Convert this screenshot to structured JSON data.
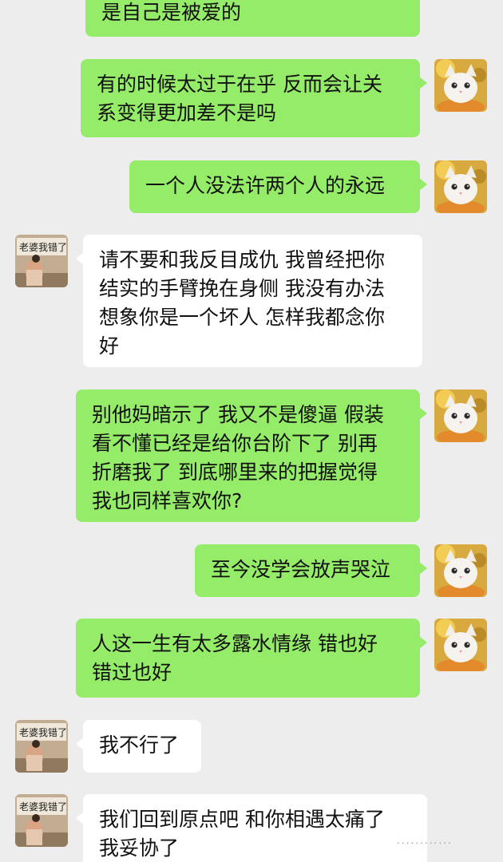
{
  "messages": [
    {
      "sender": "me",
      "text": "是自己是被爱的"
    },
    {
      "sender": "me",
      "text": "有的时候太过于在乎 反而会让关\n系变得更加差不是吗"
    },
    {
      "sender": "me",
      "text": "一个人没法许两个人的永远"
    },
    {
      "sender": "them",
      "text": "请不要和我反目成仇 我曾经把你\n结实的手臂挽在身侧 我没有办法\n想象你是一个坏人 怎样我都念你\n好"
    },
    {
      "sender": "me",
      "text": "别他妈暗示了 我又不是傻逼 假装\n看不懂已经是给你台阶下了 别再\n折磨我了 到底哪里来的把握觉得\n我也同样喜欢你?"
    },
    {
      "sender": "me",
      "text": "至今没学会放声哭泣"
    },
    {
      "sender": "me",
      "text": "人这一生有太多露水情缘 错也好\n错过也好"
    },
    {
      "sender": "them",
      "text": "我不行了"
    },
    {
      "sender": "them",
      "text": "我们回到原点吧 和你相遇太痛了\n我妥协了"
    }
  ],
  "avatars": {
    "me": {
      "icon": "kitten-avatar"
    },
    "them": {
      "icon": "person-with-sign-avatar",
      "sign_text": "老婆我错了"
    }
  },
  "watermark": "............",
  "colors": {
    "background": "#ededed",
    "my_bubble": "#95ec69",
    "their_bubble": "#ffffff"
  }
}
